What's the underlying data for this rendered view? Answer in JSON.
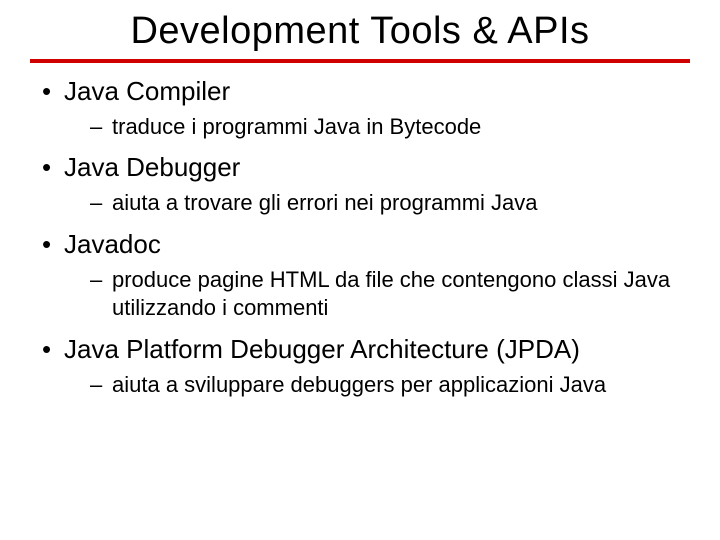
{
  "slide": {
    "title": "Development Tools & APIs",
    "items": [
      {
        "label": "Java Compiler",
        "sub": [
          "traduce i programmi Java in Bytecode"
        ]
      },
      {
        "label": "Java Debugger",
        "sub": [
          "aiuta a trovare gli errori nei programmi Java"
        ]
      },
      {
        "label": "Javadoc",
        "sub": [
          "produce pagine HTML da file che contengono classi Java utilizzando i commenti"
        ]
      },
      {
        "label": "Java Platform Debugger Architecture (JPDA)",
        "sub": [
          "aiuta a sviluppare debuggers per applicazioni Java"
        ]
      }
    ]
  }
}
